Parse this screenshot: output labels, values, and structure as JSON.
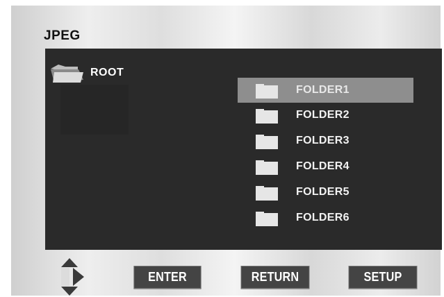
{
  "screen": {
    "title": "JPEG"
  },
  "root": {
    "label": "ROOT",
    "icon": "open-folder-icon"
  },
  "folders": [
    {
      "label": "FOLDER1",
      "selected": true
    },
    {
      "label": "FOLDER2",
      "selected": false
    },
    {
      "label": "FOLDER3",
      "selected": false
    },
    {
      "label": "FOLDER4",
      "selected": false
    },
    {
      "label": "FOLDER5",
      "selected": false
    },
    {
      "label": "FOLDER6",
      "selected": false
    }
  ],
  "buttons": {
    "enter": "ENTER",
    "return": "RETURN",
    "setup": "SETUP"
  },
  "colors": {
    "panel": "#2a2a2a",
    "selection": "#8e8e8e",
    "button": "#444444",
    "text": "#ffffff"
  }
}
